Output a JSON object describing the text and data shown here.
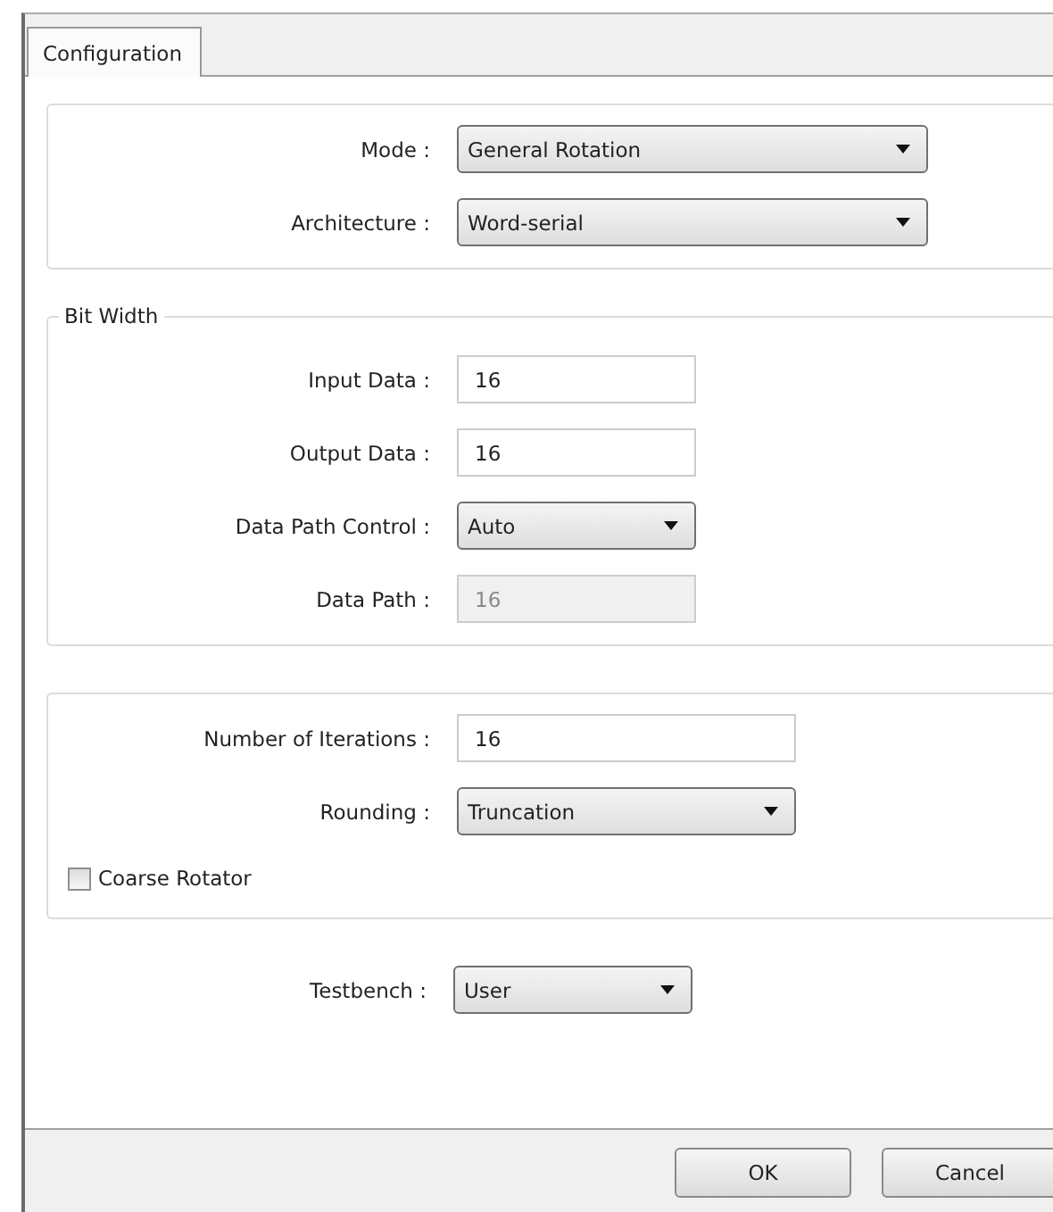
{
  "tabs": [
    {
      "label": "Configuration",
      "selected": true
    }
  ],
  "groups": [
    {
      "fields": [
        {
          "label": "Mode :",
          "kind": "select",
          "value": "General Rotation"
        },
        {
          "label": "Architecture :",
          "kind": "select",
          "value": "Word-serial"
        }
      ]
    },
    {
      "title": "Bit Width",
      "fields": [
        {
          "label": "Input Data :",
          "kind": "text",
          "value": "16",
          "disabled": false
        },
        {
          "label": "Output Data :",
          "kind": "text",
          "value": "16",
          "disabled": false
        },
        {
          "label": "Data Path Control :",
          "kind": "select",
          "value": "Auto"
        },
        {
          "label": "Data Path :",
          "kind": "text",
          "value": "16",
          "disabled": true
        }
      ]
    },
    {
      "fields": [
        {
          "label": "Number of Iterations :",
          "kind": "text",
          "value": "16",
          "disabled": false
        },
        {
          "label": "Rounding :",
          "kind": "select",
          "value": "Truncation"
        }
      ],
      "checkboxes": [
        {
          "label": "Coarse Rotator",
          "checked": false
        }
      ]
    }
  ],
  "testbench": {
    "label": "Testbench :",
    "kind": "select",
    "value": "User"
  },
  "buttons": [
    "OK",
    "Cancel"
  ]
}
